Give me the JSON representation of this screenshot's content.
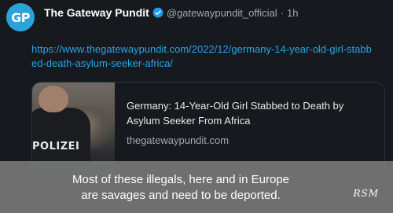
{
  "post": {
    "avatar_initials": "GP",
    "display_name": "The Gateway Pundit",
    "verified_icon": "verified-badge-icon",
    "handle": "@gatewaypundit_official",
    "separator": "·",
    "time": "1h",
    "link": "https://www.thegatewaypundit.com/2022/12/germany-14-year-old-girl-stabbed-death-asylum-seeker-africa/"
  },
  "card": {
    "image_text": "POLIZEI",
    "title": "Germany: 14-Year-Old Girl Stabbed to Death by Asylum Seeker From Africa",
    "domain": "thegatewaypundit.com"
  },
  "caption": {
    "line1": "Most of these illegals, here and in Europe",
    "line2": "are savages and need to be deported.",
    "signature": "RSM"
  },
  "colors": {
    "background": "#16191d",
    "avatar": "#2aa3d9",
    "link": "#2aa3e8",
    "verified": "#1d9bf0",
    "overlay": "#828282"
  }
}
